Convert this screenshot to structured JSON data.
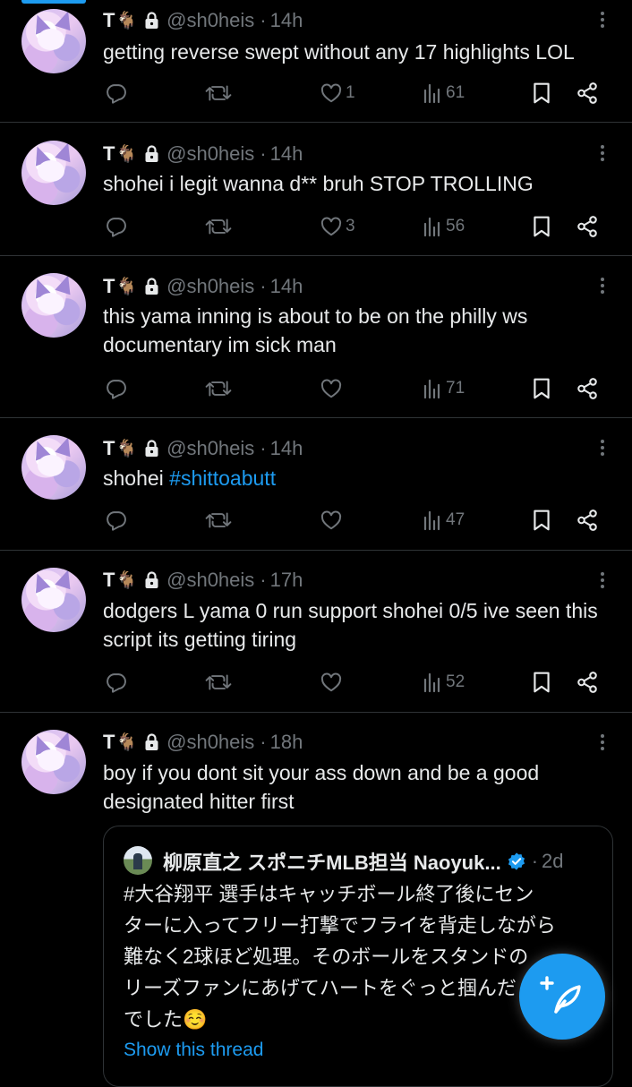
{
  "tweets": [
    {
      "name": "T",
      "goat": "🐐",
      "handle": "@sh0heis",
      "time": "14h",
      "text": "getting reverse swept without any 17 highlights LOL",
      "likes": "1",
      "views": "61"
    },
    {
      "name": "T",
      "goat": "🐐",
      "handle": "@sh0heis",
      "time": "14h",
      "text": "shohei i legit wanna d** bruh STOP TROLLING",
      "likes": "3",
      "views": "56"
    },
    {
      "name": "T",
      "goat": "🐐",
      "handle": "@sh0heis",
      "time": "14h",
      "text": "this yama inning is about to be on the philly ws documentary im sick man",
      "likes": "",
      "views": "71"
    },
    {
      "name": "T",
      "goat": "🐐",
      "handle": "@sh0heis",
      "time": "14h",
      "text_prefix": "shohei ",
      "hashtag": "#shittoabutt",
      "likes": "",
      "views": "47"
    },
    {
      "name": "T",
      "goat": "🐐",
      "handle": "@sh0heis",
      "time": "17h",
      "text": "dodgers L yama 0 run support shohei 0/5 ive seen this script its getting tiring",
      "likes": "",
      "views": "52"
    },
    {
      "name": "T",
      "goat": "🐐",
      "handle": "@sh0heis",
      "time": "18h",
      "text": "boy if you dont sit your ass down and be a good designated hitter first"
    }
  ],
  "separator": "·",
  "quote": {
    "name": "柳原直之 スポニチMLB担当 Naoyuk...",
    "time": "2d",
    "lines": [
      "#大谷翔平 選手はキャッチボール終了後にセン",
      "ターに入ってフリー打撃でフライを背走しながら",
      "難なく2球ほど処理。そのボールをスタンドの",
      "リーズファンにあげてハートをぐっと掴んだ",
      "でした☺️"
    ],
    "show_thread": "Show this thread"
  },
  "icons": {
    "reply": "reply-icon",
    "retweet": "retweet-icon",
    "like": "heart-icon",
    "views": "views-icon",
    "bookmark": "bookmark-icon",
    "share": "share-icon",
    "compose": "compose-icon"
  },
  "colors": {
    "background": "#000000",
    "text": "#e7e9ea",
    "muted": "#71767b",
    "accent": "#1d9bf0",
    "divider": "#2f3336"
  }
}
